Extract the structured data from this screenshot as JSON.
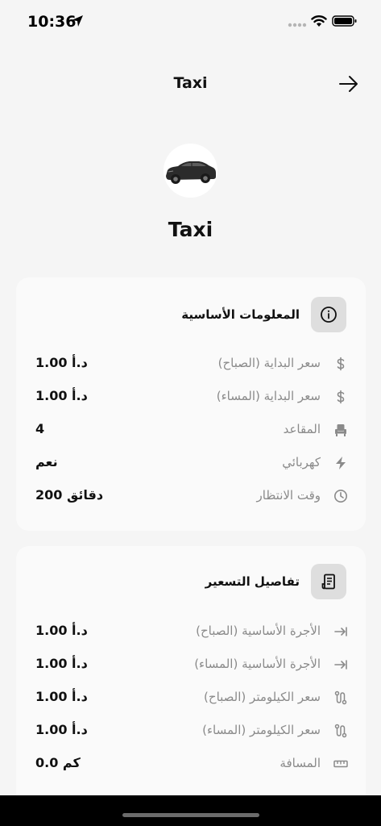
{
  "status": {
    "time": "10:36"
  },
  "header": {
    "title": "Taxi"
  },
  "profile": {
    "name": "Taxi"
  },
  "basic_info": {
    "title": "المعلومات الأساسية",
    "rows": [
      {
        "label": "سعر البداية (الصباح)",
        "value": "1.00 د.أ",
        "icon": "dollar-icon"
      },
      {
        "label": "سعر البداية (المساء)",
        "value": "1.00 د.أ",
        "icon": "dollar-icon"
      },
      {
        "label": "المقاعد",
        "value": "4",
        "icon": "seat-icon"
      },
      {
        "label": "كهربائي",
        "value": "نعم",
        "icon": "lightning-icon"
      },
      {
        "label": "وقت الانتظار",
        "value": "200 دقائق",
        "icon": "clock-icon"
      }
    ]
  },
  "pricing": {
    "title": "تفاصيل التسعير",
    "rows": [
      {
        "label": "الأجرة الأساسية (الصباح)",
        "value": "1.00 د.أ",
        "icon": "arrow-to-bar-icon"
      },
      {
        "label": "الأجرة الأساسية (المساء)",
        "value": "1.00 د.أ",
        "icon": "arrow-to-bar-icon"
      },
      {
        "label": "سعر الكيلومتر (الصباح)",
        "value": "1.00 د.أ",
        "icon": "route-icon"
      },
      {
        "label": "سعر الكيلومتر (المساء)",
        "value": "1.00 د.أ",
        "icon": "route-icon"
      },
      {
        "label": "المسافة",
        "value": "0.0 كم",
        "icon": "ruler-icon"
      }
    ]
  }
}
